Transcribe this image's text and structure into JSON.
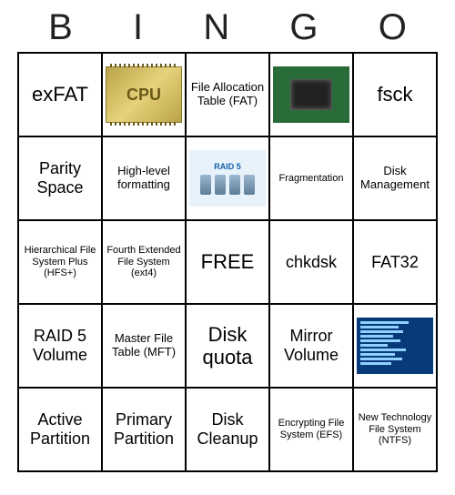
{
  "header": {
    "letters": [
      "B",
      "I",
      "N",
      "G",
      "O"
    ]
  },
  "grid": {
    "rows": [
      [
        {
          "type": "text",
          "value": "exFAT",
          "sizeClass": "fs-large"
        },
        {
          "type": "image",
          "graphic": "cpu",
          "label": "CPU"
        },
        {
          "type": "text",
          "value": "File Allocation Table (FAT)",
          "sizeClass": "fs-sm"
        },
        {
          "type": "image",
          "graphic": "chip",
          "label": ""
        },
        {
          "type": "text",
          "value": "fsck",
          "sizeClass": "fs-large"
        }
      ],
      [
        {
          "type": "text",
          "value": "Parity Space",
          "sizeClass": "fs-med"
        },
        {
          "type": "text",
          "value": "High-level formatting",
          "sizeClass": "fs-sm"
        },
        {
          "type": "image",
          "graphic": "raid5",
          "label": "RAID 5"
        },
        {
          "type": "text",
          "value": "Fragmentation",
          "sizeClass": "fs-xs"
        },
        {
          "type": "text",
          "value": "Disk Management",
          "sizeClass": "fs-sm"
        }
      ],
      [
        {
          "type": "text",
          "value": "Hierarchical File System Plus (HFS+)",
          "sizeClass": "fs-xs"
        },
        {
          "type": "text",
          "value": "Fourth Extended File System (ext4)",
          "sizeClass": "fs-xs"
        },
        {
          "type": "text",
          "value": "FREE",
          "sizeClass": "free"
        },
        {
          "type": "text",
          "value": "chkdsk",
          "sizeClass": "fs-med"
        },
        {
          "type": "text",
          "value": "FAT32",
          "sizeClass": "fs-med"
        }
      ],
      [
        {
          "type": "text",
          "value": "RAID 5 Volume",
          "sizeClass": "fs-med"
        },
        {
          "type": "text",
          "value": "Master File Table (MFT)",
          "sizeClass": "fs-sm"
        },
        {
          "type": "text",
          "value": "Disk quota",
          "sizeClass": "fs-large"
        },
        {
          "type": "text",
          "value": "Mirror Volume",
          "sizeClass": "fs-med"
        },
        {
          "type": "image",
          "graphic": "terminal",
          "label": ""
        }
      ],
      [
        {
          "type": "text",
          "value": "Active Partition",
          "sizeClass": "fs-med"
        },
        {
          "type": "text",
          "value": "Primary Partition",
          "sizeClass": "fs-med"
        },
        {
          "type": "text",
          "value": "Disk Cleanup",
          "sizeClass": "fs-med"
        },
        {
          "type": "text",
          "value": "Encrypting File System (EFS)",
          "sizeClass": "fs-xs"
        },
        {
          "type": "text",
          "value": "New Technology File System (NTFS)",
          "sizeClass": "fs-xs"
        }
      ]
    ]
  }
}
